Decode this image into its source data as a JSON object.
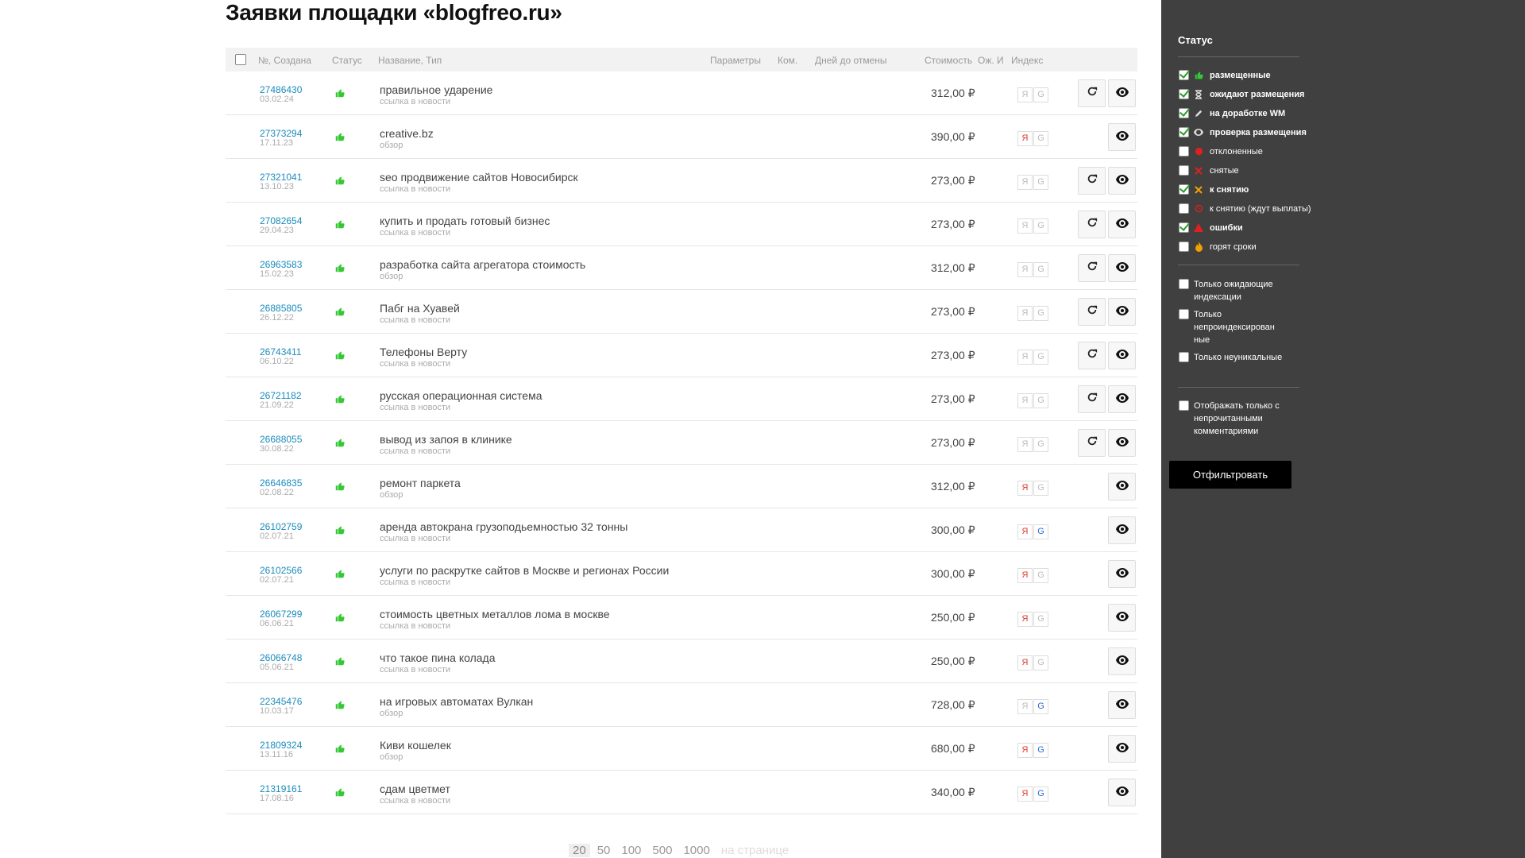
{
  "page": {
    "title": "Заявки площадки «blogfreo.ru»"
  },
  "table": {
    "headers": {
      "num": "№, Создана",
      "status": "Статус",
      "name": "Название, Тип",
      "params": "Параметры",
      "comments": "Ком.",
      "days": "Дней до отмены",
      "price": "Стоимость",
      "wait": "Ож. И",
      "index": "Индекс"
    },
    "rows": [
      {
        "num": "27486430",
        "date": "03.02.24",
        "name": "правильное ударение",
        "type": "ссылка в новости",
        "price": "312,00 ₽",
        "ya": false,
        "g": false,
        "refresh": true
      },
      {
        "num": "27373294",
        "date": "17.11.23",
        "name": "creative.bz",
        "type": "обзор",
        "price": "390,00 ₽",
        "ya": true,
        "g": false,
        "refresh": false
      },
      {
        "num": "27321041",
        "date": "13.10.23",
        "name": "seo продвижение сайтов Новосибирск",
        "type": "ссылка в новости",
        "price": "273,00 ₽",
        "ya": false,
        "g": false,
        "refresh": true
      },
      {
        "num": "27082654",
        "date": "29.04.23",
        "name": "купить и продать готовый бизнес",
        "type": "ссылка в новости",
        "price": "273,00 ₽",
        "ya": false,
        "g": false,
        "refresh": true
      },
      {
        "num": "26963583",
        "date": "15.02.23",
        "name": "разработка сайта агрегатора стоимость",
        "type": "обзор",
        "price": "312,00 ₽",
        "ya": false,
        "g": false,
        "refresh": true
      },
      {
        "num": "26885805",
        "date": "26.12.22",
        "name": "Пабг на Хуавей",
        "type": "ссылка в новости",
        "price": "273,00 ₽",
        "ya": false,
        "g": false,
        "refresh": true
      },
      {
        "num": "26743411",
        "date": "06.10.22",
        "name": "Телефоны Верту",
        "type": "ссылка в новости",
        "price": "273,00 ₽",
        "ya": false,
        "g": false,
        "refresh": true
      },
      {
        "num": "26721182",
        "date": "21.09.22",
        "name": "русская операционная система",
        "type": "ссылка в новости",
        "price": "273,00 ₽",
        "ya": false,
        "g": false,
        "refresh": true
      },
      {
        "num": "26688055",
        "date": "30.08.22",
        "name": "вывод из запоя в клинике",
        "type": "ссылка в новости",
        "price": "273,00 ₽",
        "ya": false,
        "g": false,
        "refresh": true
      },
      {
        "num": "26646835",
        "date": "02.08.22",
        "name": "ремонт паркета",
        "type": "обзор",
        "price": "312,00 ₽",
        "ya": true,
        "g": false,
        "refresh": false
      },
      {
        "num": "26102759",
        "date": "02.07.21",
        "name": "аренда автокрана грузоподьемностью 32 тонны",
        "type": "ссылка в новости",
        "price": "300,00 ₽",
        "ya": true,
        "g": true,
        "refresh": false
      },
      {
        "num": "26102566",
        "date": "02.07.21",
        "name": "услуги по раскрутке сайтов в Москве и регионах России",
        "type": "ссылка в новости",
        "price": "300,00 ₽",
        "ya": true,
        "g": false,
        "refresh": false
      },
      {
        "num": "26067299",
        "date": "06.06.21",
        "name": "стоимость цветных металлов лома в москве",
        "type": "ссылка в новости",
        "price": "250,00 ₽",
        "ya": true,
        "g": false,
        "refresh": false
      },
      {
        "num": "26066748",
        "date": "05.06.21",
        "name": "что такое пина колада",
        "type": "ссылка в новости",
        "price": "250,00 ₽",
        "ya": true,
        "g": false,
        "refresh": false
      },
      {
        "num": "22345476",
        "date": "10.03.17",
        "name": "на игровых автоматах Вулкан",
        "type": "обзор",
        "price": "728,00 ₽",
        "ya": false,
        "g": true,
        "refresh": false
      },
      {
        "num": "21809324",
        "date": "13.11.16",
        "name": "Киви кошелек",
        "type": "обзор",
        "price": "680,00 ₽",
        "ya": true,
        "g": true,
        "refresh": false
      },
      {
        "num": "21319161",
        "date": "17.08.16",
        "name": "сдам цветмет",
        "type": "ссылка в новости",
        "price": "340,00 ₽",
        "ya": true,
        "g": true,
        "refresh": false
      }
    ],
    "index_labels": {
      "ya": "Я",
      "g": "G"
    }
  },
  "pager": {
    "options": [
      "20",
      "50",
      "100",
      "500",
      "1000"
    ],
    "active": "20",
    "label": "на странице"
  },
  "sidebar": {
    "status_title": "Статус",
    "statuses": [
      {
        "label": "размещенные",
        "checked": true,
        "icon": "thumbs-up-icon",
        "color": "#34c934"
      },
      {
        "label": "ожидают размещения",
        "checked": true,
        "icon": "hourglass-icon",
        "color": "#dddddd"
      },
      {
        "label": "на доработке WM",
        "checked": true,
        "icon": "pencil-icon",
        "color": "#dddddd"
      },
      {
        "label": "проверка размещения",
        "checked": true,
        "icon": "eye-icon",
        "color": "#dddddd"
      },
      {
        "label": "отклоненные",
        "checked": false,
        "icon": "red-dot-icon",
        "color": "#e02020"
      },
      {
        "label": "снятые",
        "checked": false,
        "icon": "cross-red-icon",
        "color": "#e02020"
      },
      {
        "label": "к снятию",
        "checked": true,
        "icon": "cross-orange-icon",
        "color": "#f0a000"
      },
      {
        "label": "к снятию (ждут выплаты)",
        "checked": false,
        "icon": "clock-red-icon",
        "color": "#e02020"
      },
      {
        "label": "ошибки",
        "checked": true,
        "icon": "warning-icon",
        "color": "#e02020"
      },
      {
        "label": "горят сроки",
        "checked": false,
        "icon": "fire-icon",
        "color": "#f0a000"
      }
    ],
    "options": [
      {
        "label": "Только ожидающие индексации",
        "checked": false
      },
      {
        "label": "Только непроиндексирован ные",
        "checked": false
      },
      {
        "label": "Только неуникальные",
        "checked": false
      }
    ],
    "unread_option": {
      "label": "Отображать только с непрочитанными комментариями",
      "checked": false
    },
    "filter_button": "Отфильтровать"
  }
}
